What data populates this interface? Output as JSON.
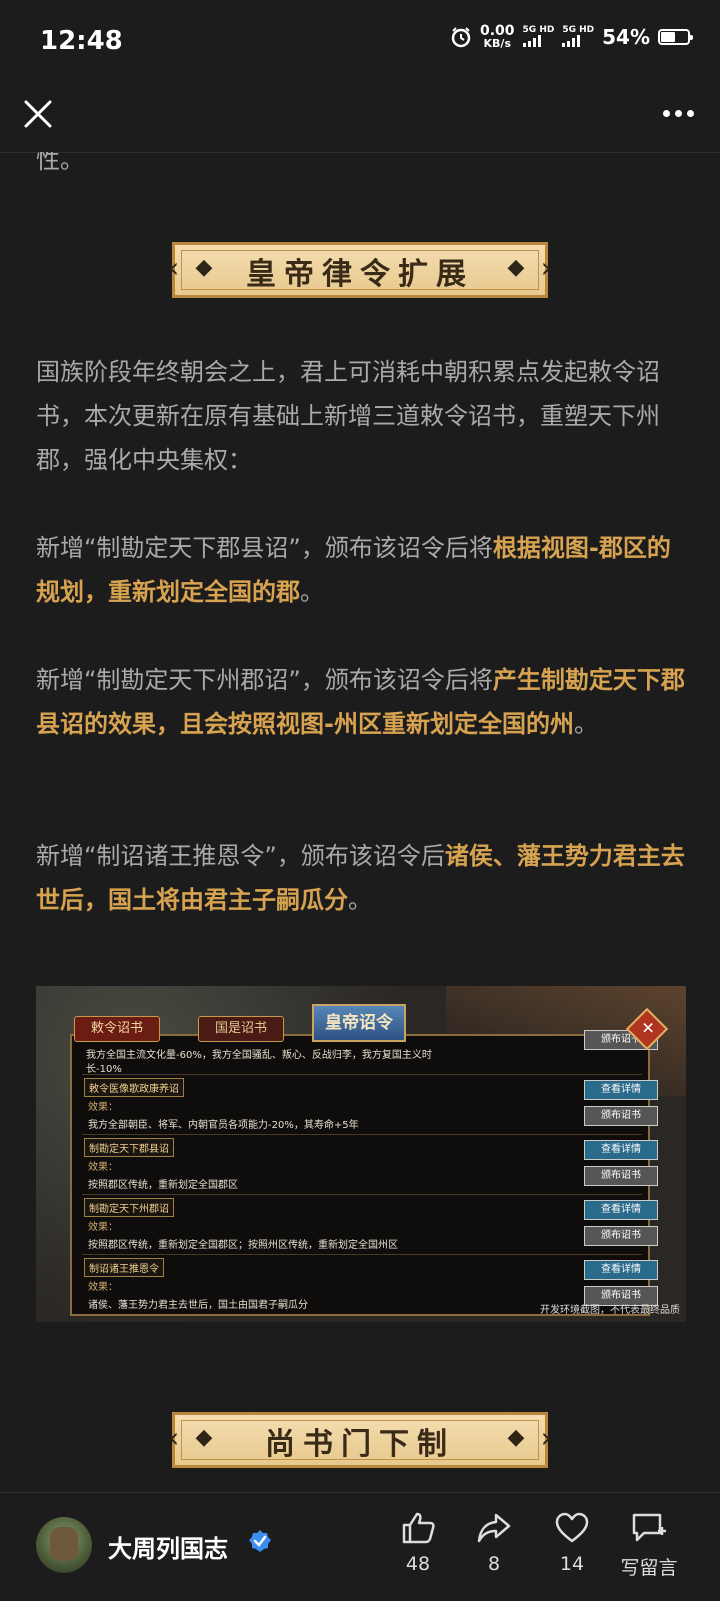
{
  "status_bar": {
    "time": "12:48",
    "net_speed_value": "0.00",
    "net_speed_unit": "KB/s",
    "sim1": "5G HD",
    "sim2": "5G HD",
    "battery_percent": "54%",
    "battery_level": 0.54
  },
  "header": {
    "close_icon": "close-icon",
    "more_icon": "more-icon"
  },
  "article": {
    "fragment": "性。",
    "banner1": "皇帝律令扩展",
    "intro": "国族阶段年终朝会之上，君上可消耗中朝积累点发起敕令诏书，本次更新在原有基础上新增三道敕令诏书，重塑天下州郡，强化中央集权：",
    "item1_plain": "新增“制勘定天下郡县诏”，颁布该诏令后将",
    "item1_highlight": "根据视图-郡区的规划，重新划定全国的郡",
    "item1_end": "。",
    "item2_plain": "新增“制勘定天下州郡诏”，颁布该诏令后将",
    "item2_highlight": "产生制勘定天下郡县诏的效果，且会按照视图-州区重新划定全国的州",
    "item2_end": "。",
    "item3_plain": "新增“制诏诸王推恩令”，颁布该诏令后",
    "item3_highlight": "诸侯、藩王势力君主去世后，国土将由君主子嗣瓜分",
    "item3_end": "。",
    "banner2": "尚书门下制"
  },
  "game_screenshot": {
    "tab1": "敕令诏书",
    "tab2": "国是诏书",
    "tab_main": "皇帝诏令",
    "close": "✕",
    "top_effect": "我方全国主流文化量-60%，我方全国骚乱、叛心、反战归李，我方复国主义时",
    "top_effect_2": "长-10%",
    "top_button": "颁布诏书",
    "edicts": [
      {
        "title": "敕令医像歌政康养诏",
        "label": "效果：",
        "effect": "我方全部朝臣、将军、内朝官员各项能力-20%，其寿命+5年",
        "detail": "查看详情",
        "issue": "颁布诏书"
      },
      {
        "title": "制勘定天下郡县诏",
        "label": "效果：",
        "effect": "按照郡区传统，重新划定全国郡区",
        "detail": "查看详情",
        "issue": "颁布诏书"
      },
      {
        "title": "制勘定天下州郡诏",
        "label": "效果：",
        "effect": "按照郡区传统，重新划定全国郡区；按照州区传统，重新划定全国州区",
        "detail": "查看详情",
        "issue": "颁布诏书"
      },
      {
        "title": "制诏诸王推恩令",
        "label": "效果：",
        "effect": "诸侯、藩王势力君主去世后，国土由国君子嗣瓜分",
        "detail": "查看详情",
        "issue": "颁布诏书"
      }
    ],
    "watermark": "开发环境截图，不代表最终品质"
  },
  "footer": {
    "author": "大周列国志",
    "likes": "48",
    "shares": "8",
    "favorites": "14",
    "comment_label": "写留言"
  }
}
